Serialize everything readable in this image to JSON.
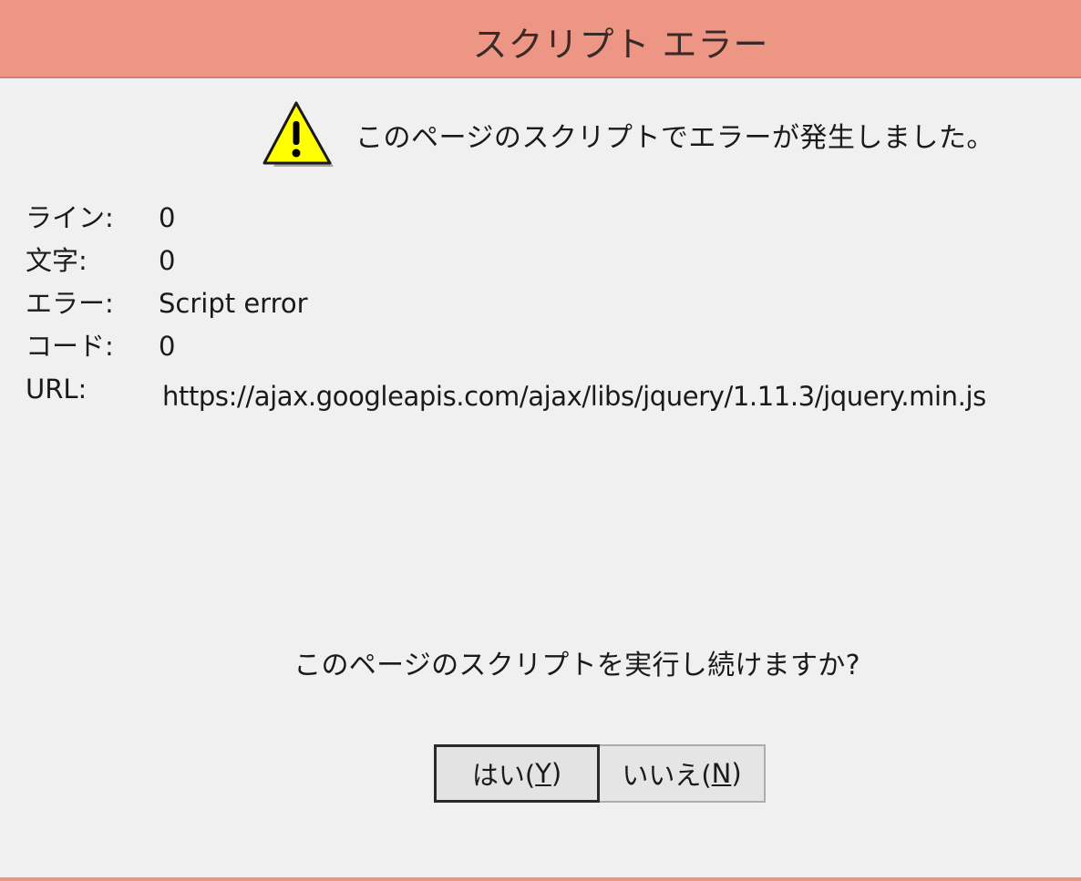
{
  "window": {
    "title": "スクリプト エラー",
    "accent_color": "#ee9685"
  },
  "message": {
    "icon": "warning-icon",
    "text": "このページのスクリプトでエラーが発生しました。"
  },
  "details": [
    {
      "label": "ライン:",
      "value": "0"
    },
    {
      "label": "文字:",
      "value": "0"
    },
    {
      "label": "エラー:",
      "value": "Script error"
    },
    {
      "label": "コード:",
      "value": "0"
    },
    {
      "label": "URL:",
      "value": "https://ajax.googleapis.com/ajax/libs/jquery/1.11.3/jquery.min.js"
    }
  ],
  "question": "このページのスクリプトを実行し続けますか?",
  "buttons": {
    "yes": {
      "label": "はい(",
      "mnemonic": "Y",
      "suffix": ")"
    },
    "no": {
      "label": "いいえ(",
      "mnemonic": "N",
      "suffix": ")"
    }
  }
}
